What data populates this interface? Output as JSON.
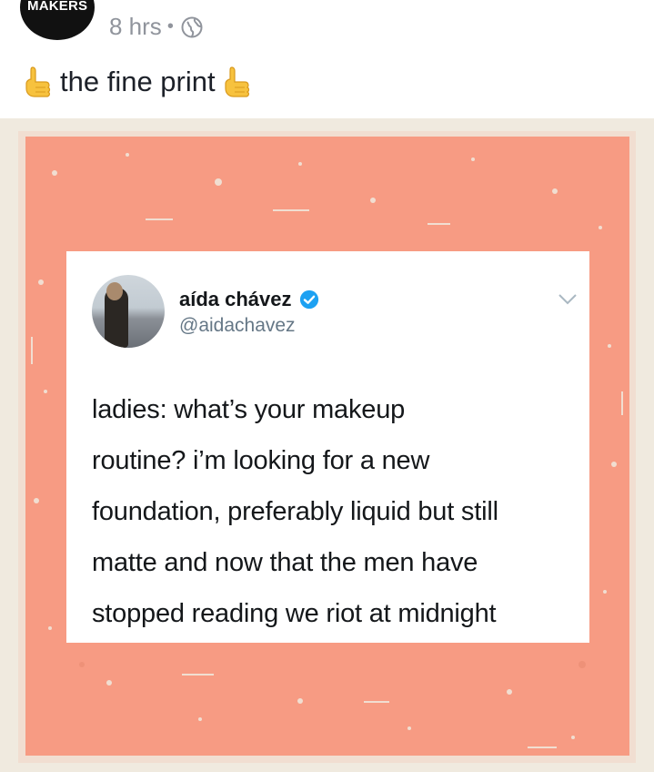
{
  "post": {
    "avatar_text": "MAKERS",
    "time": "8 hrs",
    "separator": "•",
    "privacy_icon": "globe-icon",
    "caption": "the fine print",
    "caption_icon": "pointing-hand-emoji"
  },
  "tweet": {
    "name": "aída chávez",
    "handle": "@aidachavez",
    "verified_icon": "verified-badge-icon",
    "menu_icon": "chevron-down-icon",
    "lines": [
      "ladies: what’s your makeup",
      "routine? i’m looking for a new",
      "foundation, preferably liquid but still",
      "matte and now that the men have",
      "stopped reading we riot at midnight"
    ]
  },
  "colors": {
    "background_frame": "#f0eadf",
    "salmon": "#f79b83",
    "verified_blue": "#1da1f2",
    "meta_gray": "#90949c"
  }
}
